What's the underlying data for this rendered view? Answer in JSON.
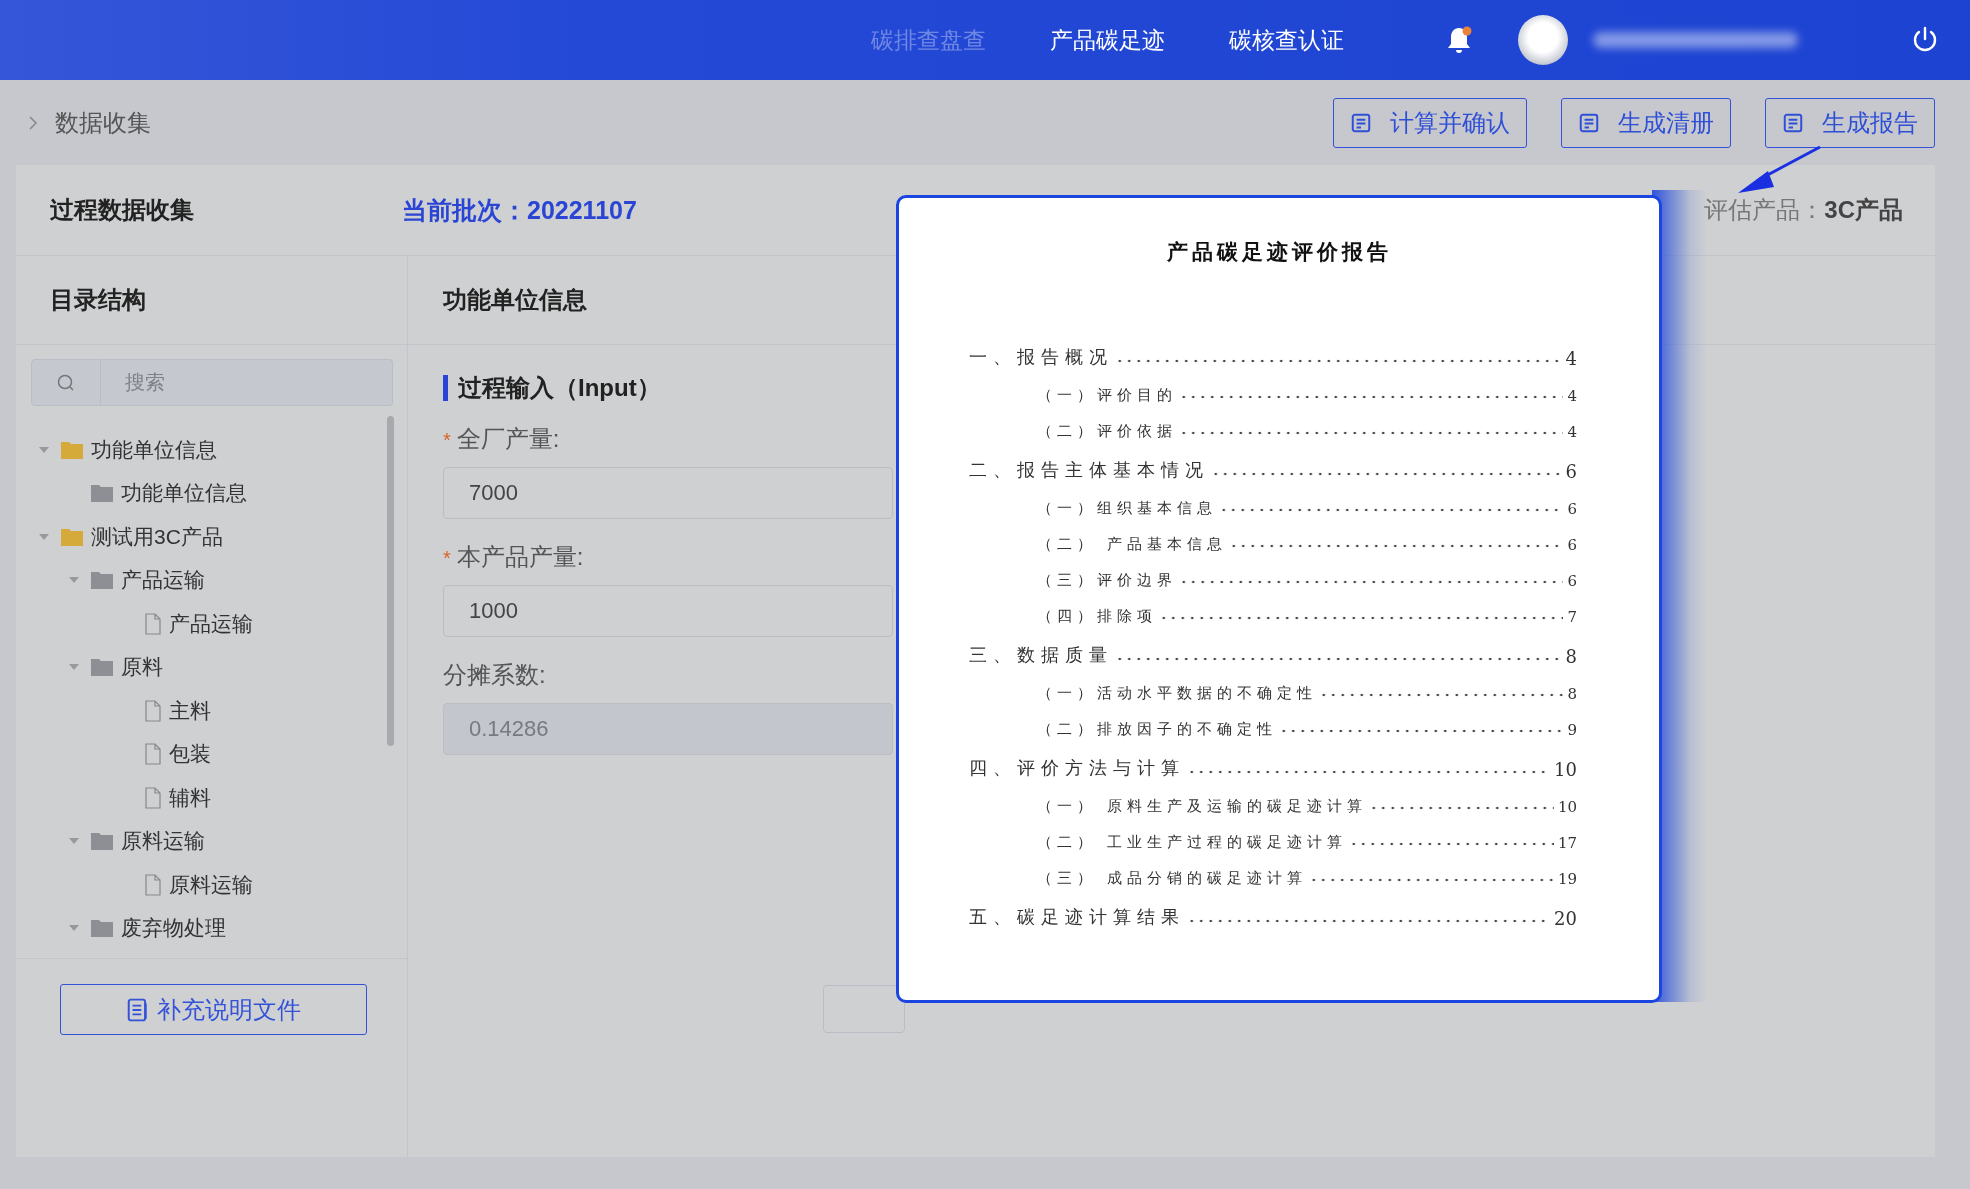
{
  "header": {
    "nav": [
      {
        "label": "碳排查盘查",
        "dimmed": true
      },
      {
        "label": "产品碳足迹",
        "dimmed": false
      },
      {
        "label": "碳核查认证",
        "dimmed": false
      }
    ],
    "notification_unread": true
  },
  "breadcrumb": {
    "current": "数据收集"
  },
  "toolbar": [
    "计算并确认",
    "生成清册",
    "生成报告"
  ],
  "panel": {
    "title": "过程数据收集",
    "batch_label": "当前批次：",
    "batch": "20221107",
    "product_label": "评估产品：",
    "product": "3C产品"
  },
  "tree": {
    "title": "目录结构",
    "search": {
      "placeholder": "搜索"
    },
    "items": [
      {
        "label": "功能单位信息",
        "kind": "root",
        "expanded": true,
        "children": [
          {
            "label": "功能单位信息",
            "kind": "folder"
          }
        ]
      },
      {
        "label": "测试用3C产品",
        "kind": "root",
        "expanded": true,
        "children": [
          {
            "label": "产品运输",
            "kind": "folder",
            "expanded": true,
            "children": [
              {
                "label": "产品运输",
                "kind": "file"
              }
            ]
          },
          {
            "label": "原料",
            "kind": "folder",
            "expanded": true,
            "children": [
              {
                "label": "主料",
                "kind": "file"
              },
              {
                "label": "包装",
                "kind": "file"
              },
              {
                "label": "辅料",
                "kind": "file"
              }
            ]
          },
          {
            "label": "原料运输",
            "kind": "folder",
            "expanded": true,
            "children": [
              {
                "label": "原料运输",
                "kind": "file"
              }
            ]
          },
          {
            "label": "废弃物处理",
            "kind": "folder",
            "expanded": true
          }
        ]
      }
    ],
    "button": "补充说明文件"
  },
  "form": {
    "title": "功能单位信息",
    "section": "过程输入（Input）",
    "required_mark": "*",
    "fields": [
      {
        "label": "全厂产量:",
        "required": true,
        "value": "7000",
        "disabled": false
      },
      {
        "label": "本产品产量:",
        "required": true,
        "value": "1000",
        "disabled": false
      },
      {
        "label": "分摊系数:",
        "required": false,
        "value": "0.14286",
        "disabled": true
      }
    ]
  },
  "report": {
    "title": "产品碳足迹评价报告",
    "toc": [
      {
        "label": "一、报告概况",
        "page": "4",
        "children": [
          {
            "label": "（一）评价目的",
            "page": "4"
          },
          {
            "label": "（二）评价依据",
            "page": "4"
          }
        ]
      },
      {
        "label": "二、报告主体基本情况",
        "page": "6",
        "children": [
          {
            "label": "（一）组织基本信息",
            "page": "6"
          },
          {
            "label": "（二） 产品基本信息",
            "page": "6"
          },
          {
            "label": "（三）评价边界",
            "page": "6"
          },
          {
            "label": "（四）排除项",
            "page": "7"
          }
        ]
      },
      {
        "label": "三、数据质量",
        "page": "8",
        "children": [
          {
            "label": "（一）活动水平数据的不确定性",
            "page": "8"
          },
          {
            "label": "（二）排放因子的不确定性",
            "page": "9"
          }
        ]
      },
      {
        "label": "四、评价方法与计算",
        "page": "10",
        "children": [
          {
            "label": "（一） 原料生产及运输的碳足迹计算",
            "page": "10"
          },
          {
            "label": "（二） 工业生产过程的碳足迹计算",
            "page": "17"
          },
          {
            "label": "（三） 成品分销的碳足迹计算",
            "page": "19"
          }
        ]
      },
      {
        "label": "五、碳足迹计算结果",
        "page": "20"
      }
    ]
  }
}
